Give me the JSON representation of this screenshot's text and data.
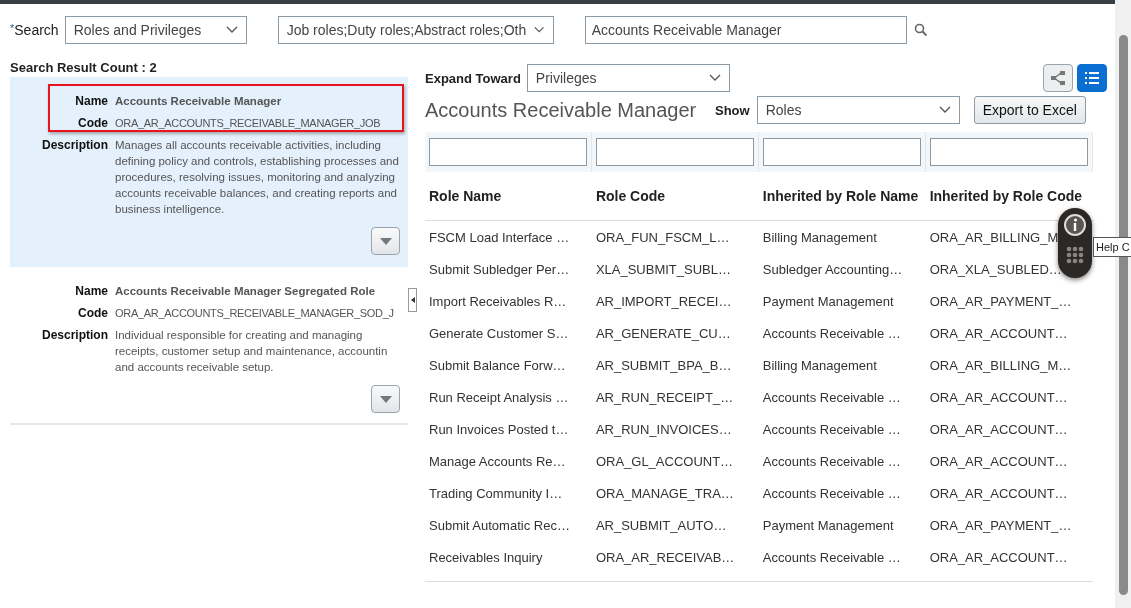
{
  "search_bar": {
    "required_mark": "*",
    "label": "Search",
    "type_select": {
      "value": "Roles and Privileges"
    },
    "role_types_select": {
      "value": "Job roles;Duty roles;Abstract roles;Oth"
    },
    "keyword_field": {
      "value": "Accounts Receivable Manager"
    }
  },
  "results": {
    "count_label": "Search Result Count : 2",
    "items": [
      {
        "selected": true,
        "highlighted": true,
        "name_label": "Name",
        "name": "Accounts Receivable Manager",
        "code_label": "Code",
        "code": "ORA_AR_ACCOUNTS_RECEIVABLE_MANAGER_JOB",
        "description_label": "Description",
        "description": "Manages all accounts receivable activities, including defining policy and controls, establishing processes and procedures, resolving issues, monitoring and analyzing accounts receivable balances, and creating reports and business intelligence."
      },
      {
        "selected": false,
        "highlighted": false,
        "name_label": "Name",
        "name": "Accounts Receivable Manager Segregated Role",
        "code_label": "Code",
        "code": "ORA_AR_ACCOUNTS_RECEIVABLE_MANAGER_SOD_J",
        "description_label": "Description",
        "description": "Individual responsible for creating and managing receipts, customer setup and maintenance, accountin and accounts receivable setup."
      }
    ]
  },
  "detail": {
    "expand_label": "Expand Toward",
    "expand_select": {
      "value": "Privileges"
    },
    "views": [
      {
        "kind": "hierarchy",
        "selected": false
      },
      {
        "kind": "list",
        "selected": true
      }
    ],
    "title": "Accounts Receivable Manager",
    "show_label": "Show",
    "show_select": {
      "value": "Roles"
    },
    "export_button": "Export to Excel",
    "table": {
      "columns": [
        "Role Name",
        "Role Code",
        "Inherited by Role Name",
        "Inherited by Role Code"
      ],
      "rows": [
        [
          "FSCM Load Interface …",
          "ORA_FUN_FSCM_L…",
          "Billing Management",
          "ORA_AR_BILLING_M"
        ],
        [
          "Submit Subledger Per…",
          "XLA_SUBMIT_SUBL…",
          "Subledger Accounting…",
          "ORA_XLA_SUBLED…"
        ],
        [
          "Import Receivables R…",
          "AR_IMPORT_RECEI…",
          "Payment Management",
          "ORA_AR_PAYMENT_…"
        ],
        [
          "Generate Customer S…",
          "AR_GENERATE_CU…",
          "Accounts Receivable …",
          "ORA_AR_ACCOUNT…"
        ],
        [
          "Submit Balance Forw…",
          "AR_SUBMIT_BPA_B…",
          "Billing Management",
          "ORA_AR_BILLING_M…"
        ],
        [
          "Run Receipt Analysis …",
          "AR_RUN_RECEIPT_…",
          "Accounts Receivable …",
          "ORA_AR_ACCOUNT…"
        ],
        [
          "Run Invoices Posted t…",
          "AR_RUN_INVOICES…",
          "Accounts Receivable …",
          "ORA_AR_ACCOUNT…"
        ],
        [
          "Manage Accounts Re…",
          "ORA_GL_ACCOUNT…",
          "Accounts Receivable …",
          "ORA_AR_ACCOUNT…"
        ],
        [
          "Trading Community I…",
          "ORA_MANAGE_TRA…",
          "Accounts Receivable …",
          "ORA_AR_ACCOUNT…"
        ],
        [
          "Submit Automatic Rec…",
          "AR_SUBMIT_AUTO…",
          "Payment Management",
          "ORA_AR_PAYMENT_…"
        ],
        [
          "Receivables Inquiry",
          "ORA_AR_RECEIVAB…",
          "Accounts Receivable …",
          "ORA_AR_ACCOUNT…"
        ]
      ]
    }
  },
  "help_widget": {
    "tooltip": "Help C"
  }
}
